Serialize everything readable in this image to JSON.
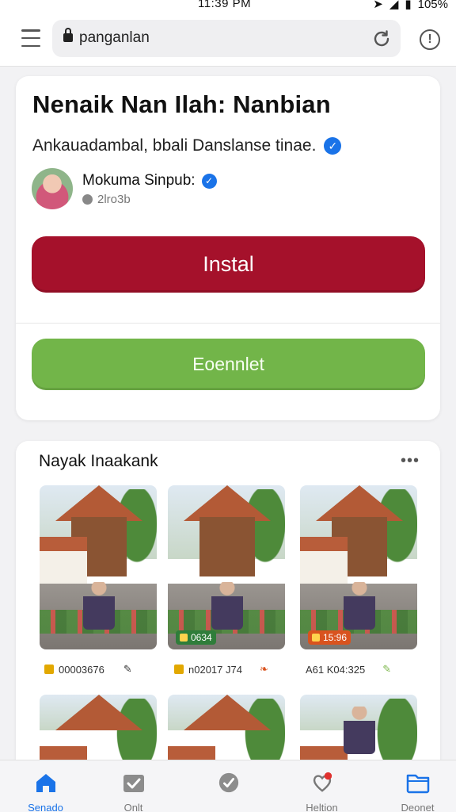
{
  "status": {
    "time": "11:39 PM",
    "battery": "105%"
  },
  "browser": {
    "url": "panganka n",
    "url_text": "panganlan"
  },
  "post": {
    "headline": "Nenaik Nan Ilah: Nanbian",
    "subline": "Ankauadambal, bbali Danslanse tinae.",
    "author_name": "Mokuma Sinpub:",
    "author_meta": "2lro3b",
    "install_label": "Instal",
    "connect_label": "Eoennlet"
  },
  "gallery": {
    "title": "Nayak Inaakank",
    "more": "•••",
    "thumbs": [
      {
        "badge": "",
        "meta": "00003676"
      },
      {
        "badge": "0634",
        "meta": "n02017 J74"
      },
      {
        "badge": "15:96",
        "meta": "A61 K04:325"
      },
      {
        "badge": "",
        "meta": ""
      },
      {
        "badge": "",
        "meta": ""
      },
      {
        "badge": "",
        "meta": ""
      }
    ]
  },
  "tabs": [
    {
      "label": "Senado",
      "icon": "home-icon"
    },
    {
      "label": "Onlt",
      "icon": "check-folder-icon"
    },
    {
      "label": "",
      "icon": "check-circle-icon"
    },
    {
      "label": "Heltion",
      "icon": "heart-notification-icon"
    },
    {
      "label": "Deonet",
      "icon": "folder-icon"
    }
  ],
  "colors": {
    "install": "#a5112b",
    "connect": "#72b549",
    "accent": "#1a73e8"
  }
}
